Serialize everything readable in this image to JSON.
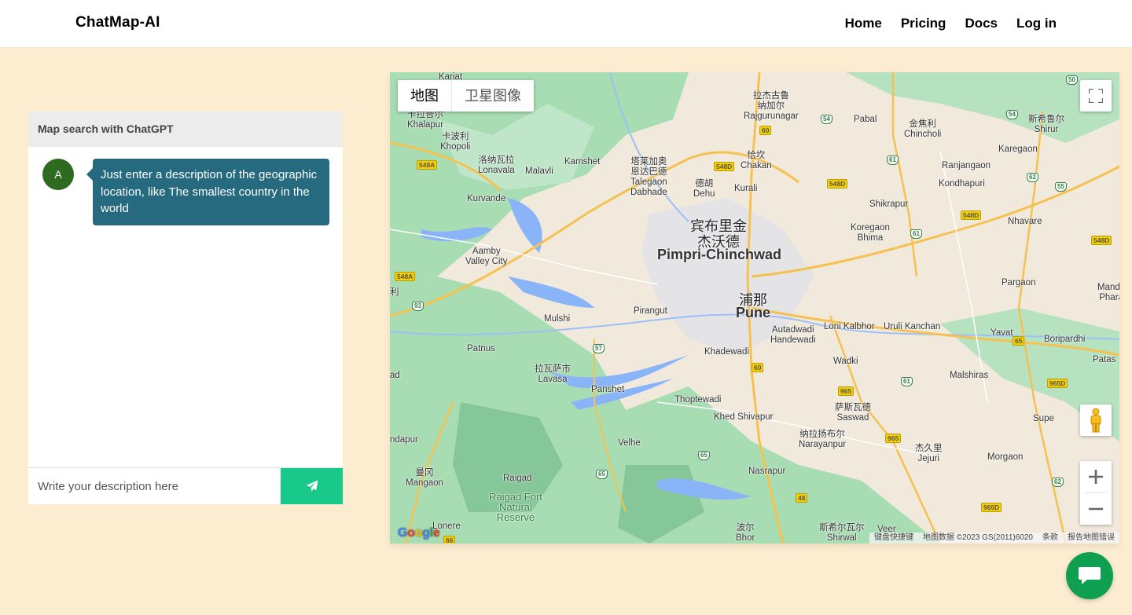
{
  "header": {
    "brand": "ChatMap-AI",
    "nav": [
      "Home",
      "Pricing",
      "Docs",
      "Log in"
    ]
  },
  "chat": {
    "title": "Map search with ChatGPT",
    "messages": [
      {
        "avatar": "A",
        "text": "Just enter a description of the geographic location, like The smallest country in the world"
      }
    ],
    "input_placeholder": "Write your description here",
    "send_icon": "paper-plane-icon"
  },
  "map": {
    "map_types": [
      "地图",
      "卫星图像"
    ],
    "active_map_type": "地图",
    "controls": [
      "fullscreen-icon",
      "pegman-icon",
      "zoom-in-icon",
      "zoom-out-icon"
    ],
    "logo": "Google",
    "attribution": [
      "键盘快捷键",
      "地图数据 ©2023 GS(2011)6020",
      "条款",
      "报告地图错误"
    ],
    "places": [
      {
        "name": "Kariat"
      },
      {
        "name": "拉杰古鲁\n纳加尔\nRajgurunagar"
      },
      {
        "name": "卡拉普尔\nKhalapur"
      },
      {
        "name": "卡波利\nKhopoli"
      },
      {
        "name": "洛纳瓦拉\nLonavala"
      },
      {
        "name": "Malavli"
      },
      {
        "name": "Kamshet"
      },
      {
        "name": "塔莱加奥\n恩达巴德\nTalegaon\nDabhade"
      },
      {
        "name": "德胡\nDehu"
      },
      {
        "name": "恰坎\nChakan"
      },
      {
        "name": "Kurali"
      },
      {
        "name": "Pabal"
      },
      {
        "name": "金焦利\nChincholi"
      },
      {
        "name": "斯希鲁尔\nShirur"
      },
      {
        "name": "Karegaon"
      },
      {
        "name": "Ranjangaon"
      },
      {
        "name": "Kondhapuri"
      },
      {
        "name": "Kurvande"
      },
      {
        "name": "宾布里金\n杰沃德"
      },
      {
        "name": "Pimpri-Chinchwad"
      },
      {
        "name": "Shikrapur"
      },
      {
        "name": "Koregaon\nBhima"
      },
      {
        "name": "Nhavare"
      },
      {
        "name": "Aamby\nValley City"
      },
      {
        "name": "浦那"
      },
      {
        "name": "Pune"
      },
      {
        "name": "Pargaon"
      },
      {
        "name": "Manda\nPhara"
      },
      {
        "name": "Pirangut"
      },
      {
        "name": "Mulshi"
      },
      {
        "name": "Loni Kalbhor"
      },
      {
        "name": "Uruli Kanchan"
      },
      {
        "name": "Autadwadi\nHandewadi"
      },
      {
        "name": "Yavat"
      },
      {
        "name": "Boripardhi"
      },
      {
        "name": "Patnus"
      },
      {
        "name": "Khadewadi"
      },
      {
        "name": "拉瓦萨市\nLavasa"
      },
      {
        "name": "Wadki"
      },
      {
        "name": "Patas"
      },
      {
        "name": "Malshiras"
      },
      {
        "name": "Panshet"
      },
      {
        "name": "Thoptewadi"
      },
      {
        "name": "萨斯瓦德\nSaswad"
      },
      {
        "name": "Khed Shivapur"
      },
      {
        "name": "Supe"
      },
      {
        "name": "ndapur"
      },
      {
        "name": "纳拉扬布尔\nNarayanpur"
      },
      {
        "name": "杰久里\nJejuri"
      },
      {
        "name": "Velhe"
      },
      {
        "name": "曼冈\nMangaon"
      },
      {
        "name": "Raigad"
      },
      {
        "name": "Morgaon"
      },
      {
        "name": "Nasrapur"
      },
      {
        "name": "Raigad Fort\nNatural\nReserve"
      },
      {
        "name": "Lonere"
      },
      {
        "name": "波尔\nBhor"
      },
      {
        "name": "斯希尔瓦尔\nShirwal"
      },
      {
        "name": "Veer"
      },
      {
        "name": "ad"
      },
      {
        "name": "利"
      }
    ],
    "shields": [
      "50",
      "54",
      "54",
      "60",
      "548D",
      "548D",
      "61",
      "62",
      "55",
      "548A",
      "548D",
      "61",
      "548D",
      "548A",
      "93",
      "57",
      "65",
      "60",
      "61",
      "965",
      "965D",
      "965",
      "65",
      "65",
      "62",
      "48",
      "965D",
      "66"
    ]
  },
  "chat_fab_icon": "chat-bubble-icon"
}
